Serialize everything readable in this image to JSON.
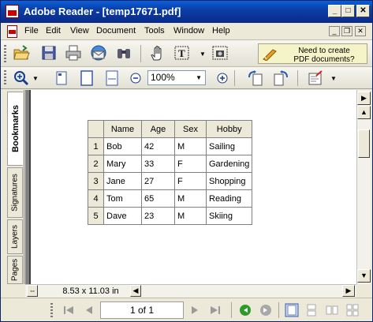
{
  "window": {
    "title": "Adobe Reader - [temp17671.pdf]",
    "controls": {
      "minimize": "_",
      "maximize": "□",
      "close": "✕"
    }
  },
  "menubar": {
    "items": [
      "File",
      "Edit",
      "View",
      "Document",
      "Tools",
      "Window",
      "Help"
    ],
    "mdi": {
      "minimize": "_",
      "restore": "❐",
      "close": "✕"
    }
  },
  "toolbar": {
    "icons": [
      "open-icon",
      "save-icon",
      "print-icon",
      "email-icon",
      "search-icon",
      "hand-tool-icon",
      "select-text-icon",
      "snapshot-icon"
    ],
    "promo_line1": "Need to create",
    "promo_line2": "PDF documents?",
    "zoom_value": "100%"
  },
  "side_tabs": [
    "Bookmarks",
    "Signatures",
    "Layers",
    "Pages"
  ],
  "table": {
    "headers": [
      "",
      "Name",
      "Age",
      "Sex",
      "Hobby"
    ],
    "rows": [
      [
        "1",
        "Bob",
        "42",
        "M",
        "Sailing"
      ],
      [
        "2",
        "Mary",
        "33",
        "F",
        "Gardening"
      ],
      [
        "3",
        "Jane",
        "27",
        "F",
        "Shopping"
      ],
      [
        "4",
        "Tom",
        "65",
        "M",
        "Reading"
      ],
      [
        "5",
        "Dave",
        "23",
        "M",
        "Skiing"
      ]
    ]
  },
  "status": {
    "page_size": "8.53 x 11.03 in",
    "page_indicator": "1 of 1"
  },
  "colors": {
    "title_bar": "#0a3fa8",
    "promo_bg": "#f5f3c8",
    "go_green": "#2e9a2e"
  }
}
